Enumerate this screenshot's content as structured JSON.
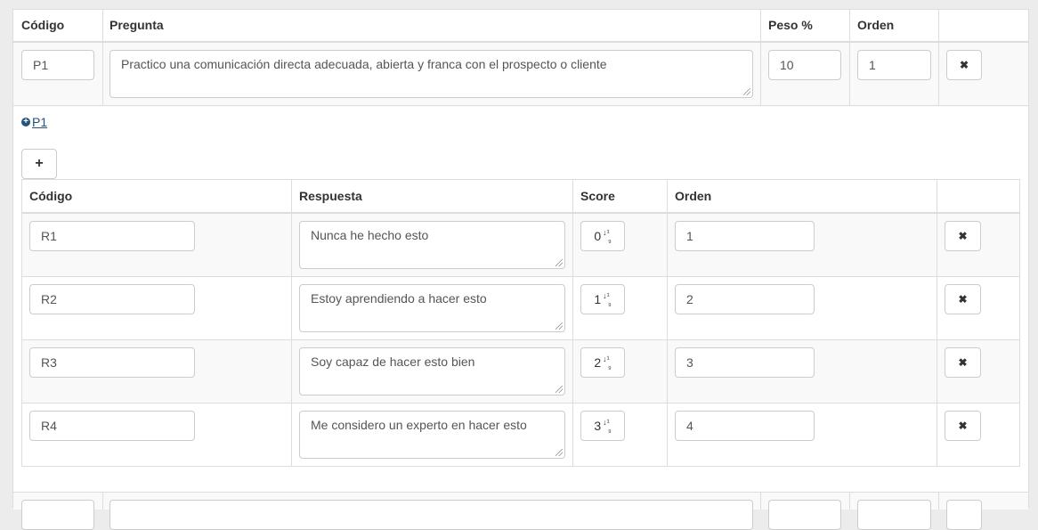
{
  "question_table": {
    "headers": {
      "code": "Código",
      "question": "Pregunta",
      "weight": "Peso %",
      "order": "Orden"
    },
    "row": {
      "code": "P1",
      "question": "Practico una comunicación directa adecuada, abierta y franca con el prospecto o cliente",
      "weight": "10",
      "order": "1",
      "delete_icon": "✖"
    }
  },
  "toggle": {
    "icon": "⊕",
    "label": "P1"
  },
  "add_button": {
    "label": "+"
  },
  "answers_table": {
    "headers": {
      "code": "Código",
      "answer": "Respuesta",
      "score": "Score",
      "order": "Orden"
    },
    "rows": [
      {
        "code": "R1",
        "answer": "Nunca he hecho esto",
        "score": "0",
        "order": "1"
      },
      {
        "code": "R2",
        "answer": "Estoy aprendiendo a hacer esto",
        "score": "1",
        "order": "2"
      },
      {
        "code": "R3",
        "answer": "Soy capaz de hacer esto bien",
        "score": "2",
        "order": "3"
      },
      {
        "code": "R4",
        "answer": "Me considero un experto en hacer esto",
        "score": "3",
        "order": "4"
      }
    ],
    "delete_icon": "✖",
    "sort_icon": "sort-numeric-icon"
  }
}
